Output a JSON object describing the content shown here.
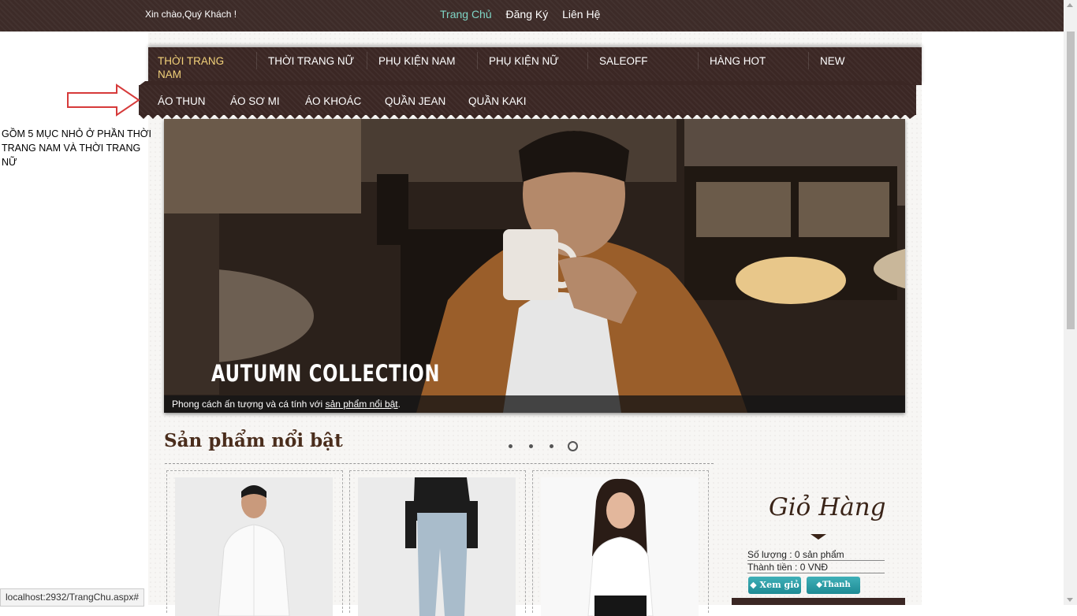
{
  "header": {
    "greeting": "Xin chào,Quý Khách !",
    "links": [
      "Trang Chủ",
      "Đăng Ký",
      "Liên Hệ"
    ]
  },
  "nav": {
    "items": [
      "THỜI TRANG NAM",
      "THỜI TRANG NỮ",
      "PHỤ KIỆN NAM",
      "PHỤ KIỆN NỮ",
      "SALEOFF",
      "HÀNG HOT",
      "NEW"
    ],
    "sub_items": [
      "ÁO THUN",
      "ÁO SƠ MI",
      "ÁO KHOÁC",
      "QUẦN JEAN",
      "QUẦN KAKI"
    ]
  },
  "annotation": {
    "text": "GỒM 5 MỤC NHỎ Ở PHẦN THỜI TRANG NAM VÀ THỜI TRANG NỮ"
  },
  "banner": {
    "headline": "AUTUMN COLLECTION",
    "caption_prefix": "Phong cách ấn tượng và cá tính với ",
    "caption_link": "sản phẩm nổi bật",
    "caption_suffix": "."
  },
  "featured": {
    "title": "Sản phẩm nổi bật",
    "slide_count": 4,
    "active_slide": 4
  },
  "cart": {
    "title": "Giỏ Hàng",
    "quantity_line": "Số lượng : 0 sản phẩm",
    "total_line": "Thành tiền : 0 VNĐ",
    "view_button": "Xem giỏ",
    "checkout_button": "Thanh toán"
  },
  "statusbar": {
    "url": "localhost:2932/TrangChu.aspx#"
  },
  "colors": {
    "header_bg": "#3d2b28",
    "active_link": "#7fd6c6",
    "nav_active": "#f3d27a",
    "accent_button": "#1e8a94"
  }
}
